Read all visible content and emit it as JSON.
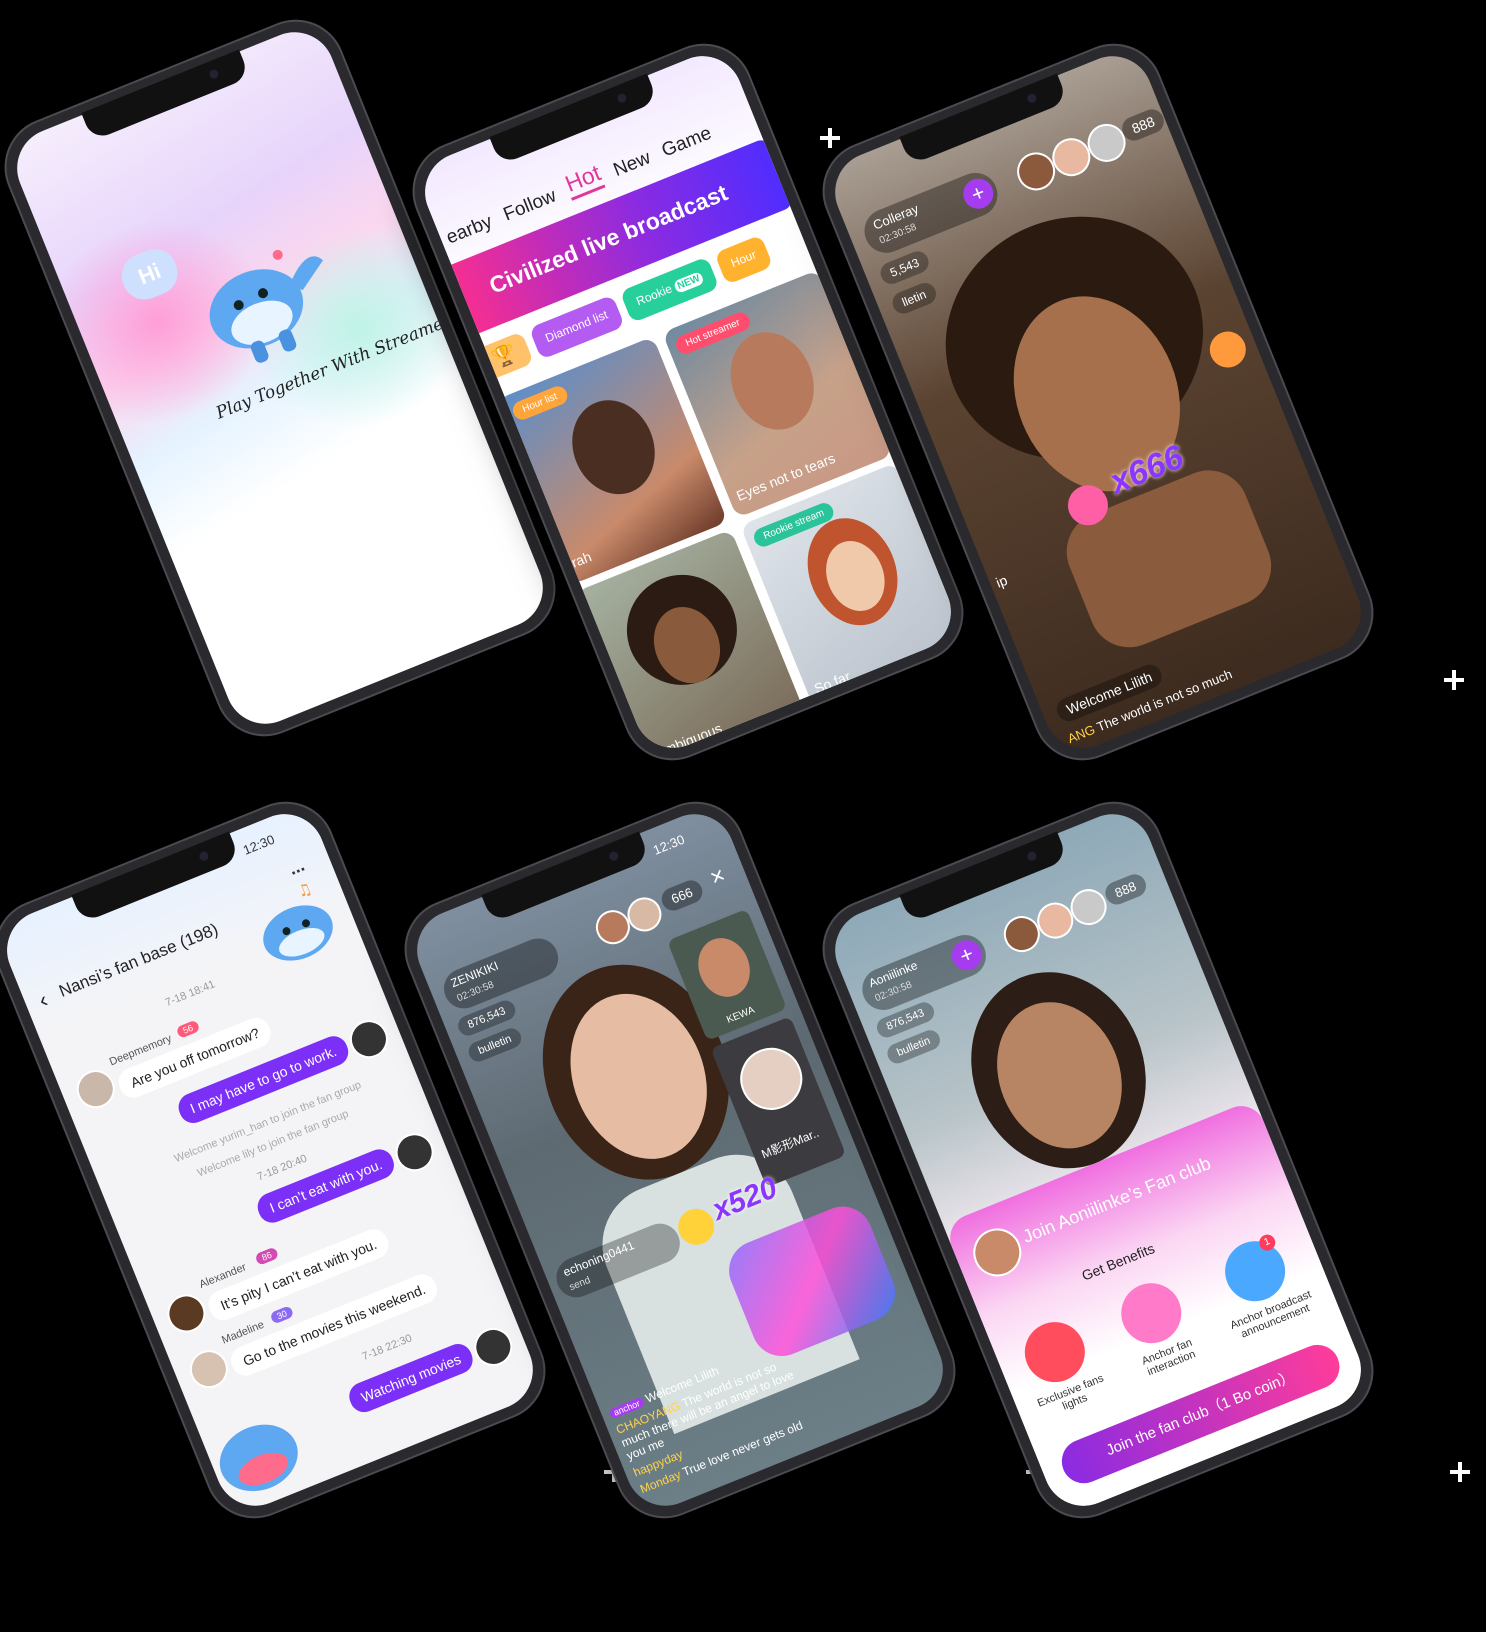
{
  "splash": {
    "greeting": "Hi",
    "tagline": "Play Together With Streamers"
  },
  "hot": {
    "tabs": [
      "earby",
      "Follow",
      "Hot",
      "New",
      "Game"
    ],
    "banner": "Civilized live broadcast",
    "chips": [
      "Diamond list",
      "Rookie",
      "Hour"
    ],
    "badge_new": "NEW",
    "tags": {
      "hour_list": "Hour list",
      "hot_streamer": "Hot streamer",
      "rookie_streamer": "Rookie stream"
    },
    "cards": [
      "rah",
      "Eyes not to tears",
      "r ambiguous",
      "So far"
    ]
  },
  "live1": {
    "host": "Colleray",
    "time": "02:30:58",
    "count": "5,543",
    "bulletin": "lletin",
    "viewers": "888",
    "combo": "x666",
    "side": "ip",
    "welcome": "Welcome Lilith",
    "msg_user": "ANG",
    "msg": "The world is not so much"
  },
  "chat": {
    "time_status": "12:30",
    "title": "Nansi’s fan base",
    "member_count": "(198)",
    "more": "...",
    "messages": [
      {
        "kind": "time",
        "text": "7-18 18:41"
      },
      {
        "kind": "in",
        "user": "Deepmemory",
        "level": "56",
        "text": "Are you off tomorrow?"
      },
      {
        "kind": "out",
        "text": "I may have to go to work."
      },
      {
        "kind": "system",
        "text": "Welcome yurim_han to join the fan group"
      },
      {
        "kind": "system",
        "text": "Welcome lily to join the fan group"
      },
      {
        "kind": "time",
        "text": "7-18 20:40"
      },
      {
        "kind": "out",
        "text": "I can’t eat with you."
      },
      {
        "kind": "in",
        "user": "Alexander",
        "level": "86",
        "text": "It’s pity I can’t eat with you."
      },
      {
        "kind": "in",
        "user": "Madeline",
        "level": "30",
        "text": "Go to the movies this weekend."
      },
      {
        "kind": "time",
        "text": "7-18 22:30"
      },
      {
        "kind": "out",
        "text": "Watching movies"
      }
    ]
  },
  "live2": {
    "time_status": "12:30",
    "host": "ZENIKIKI",
    "time": "02:30:58",
    "count": "876,543",
    "bulletin": "bulletin",
    "viewers": "666",
    "close": "×",
    "pk1": "KEWA",
    "pk2": "M影形Mar..",
    "gifter": "echoning0441",
    "gift_action": "send",
    "combo": "x520",
    "chat": [
      {
        "badge": "anchor",
        "user": "",
        "text": "Welcome Lilith"
      },
      {
        "badge": "",
        "user": "CHAOYANG",
        "text": "The world is not so much there will be an angel to love you me"
      },
      {
        "badge": "",
        "user": "happyday",
        "text": ""
      },
      {
        "badge": "",
        "user": "Monday",
        "text": "True love never gets old"
      }
    ]
  },
  "fan": {
    "host": "Aoniilinke",
    "time": "02:30:58",
    "count": "876,543",
    "bulletin": "bulletin",
    "viewers": "888",
    "title": "Join Aoniilinke’s Fan club",
    "benefits": "Get Benefits",
    "items": [
      "Exclusive fans lights",
      "Anchor fan interaction",
      "Anchor broadcast announcement"
    ],
    "bell_badge": "1",
    "cta": "Join the fan club（1 Bo coin）"
  },
  "colors": {
    "accent": "#8a2be2",
    "pink": "#ff3c9a",
    "chat_bubble": "#7b2ff7"
  }
}
